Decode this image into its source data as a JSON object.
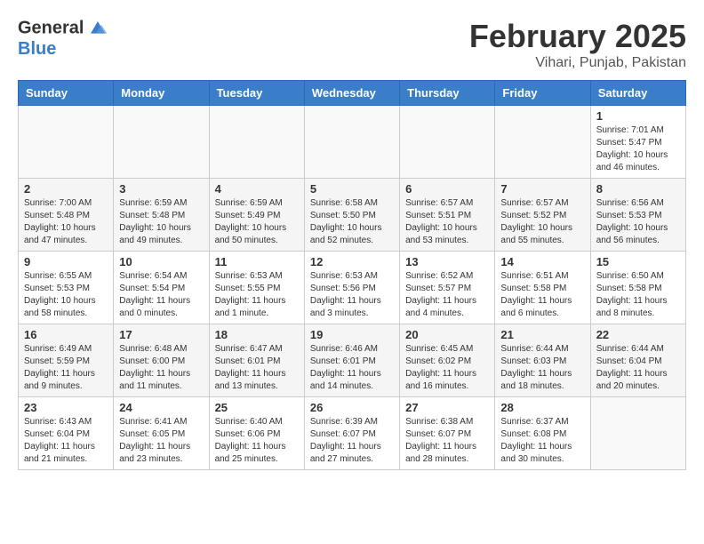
{
  "header": {
    "logo_general": "General",
    "logo_blue": "Blue",
    "month_year": "February 2025",
    "location": "Vihari, Punjab, Pakistan"
  },
  "weekdays": [
    "Sunday",
    "Monday",
    "Tuesday",
    "Wednesday",
    "Thursday",
    "Friday",
    "Saturday"
  ],
  "weeks": [
    [
      {
        "day": "",
        "info": ""
      },
      {
        "day": "",
        "info": ""
      },
      {
        "day": "",
        "info": ""
      },
      {
        "day": "",
        "info": ""
      },
      {
        "day": "",
        "info": ""
      },
      {
        "day": "",
        "info": ""
      },
      {
        "day": "1",
        "info": "Sunrise: 7:01 AM\nSunset: 5:47 PM\nDaylight: 10 hours and 46 minutes."
      }
    ],
    [
      {
        "day": "2",
        "info": "Sunrise: 7:00 AM\nSunset: 5:48 PM\nDaylight: 10 hours and 47 minutes."
      },
      {
        "day": "3",
        "info": "Sunrise: 6:59 AM\nSunset: 5:48 PM\nDaylight: 10 hours and 49 minutes."
      },
      {
        "day": "4",
        "info": "Sunrise: 6:59 AM\nSunset: 5:49 PM\nDaylight: 10 hours and 50 minutes."
      },
      {
        "day": "5",
        "info": "Sunrise: 6:58 AM\nSunset: 5:50 PM\nDaylight: 10 hours and 52 minutes."
      },
      {
        "day": "6",
        "info": "Sunrise: 6:57 AM\nSunset: 5:51 PM\nDaylight: 10 hours and 53 minutes."
      },
      {
        "day": "7",
        "info": "Sunrise: 6:57 AM\nSunset: 5:52 PM\nDaylight: 10 hours and 55 minutes."
      },
      {
        "day": "8",
        "info": "Sunrise: 6:56 AM\nSunset: 5:53 PM\nDaylight: 10 hours and 56 minutes."
      }
    ],
    [
      {
        "day": "9",
        "info": "Sunrise: 6:55 AM\nSunset: 5:53 PM\nDaylight: 10 hours and 58 minutes."
      },
      {
        "day": "10",
        "info": "Sunrise: 6:54 AM\nSunset: 5:54 PM\nDaylight: 11 hours and 0 minutes."
      },
      {
        "day": "11",
        "info": "Sunrise: 6:53 AM\nSunset: 5:55 PM\nDaylight: 11 hours and 1 minute."
      },
      {
        "day": "12",
        "info": "Sunrise: 6:53 AM\nSunset: 5:56 PM\nDaylight: 11 hours and 3 minutes."
      },
      {
        "day": "13",
        "info": "Sunrise: 6:52 AM\nSunset: 5:57 PM\nDaylight: 11 hours and 4 minutes."
      },
      {
        "day": "14",
        "info": "Sunrise: 6:51 AM\nSunset: 5:58 PM\nDaylight: 11 hours and 6 minutes."
      },
      {
        "day": "15",
        "info": "Sunrise: 6:50 AM\nSunset: 5:58 PM\nDaylight: 11 hours and 8 minutes."
      }
    ],
    [
      {
        "day": "16",
        "info": "Sunrise: 6:49 AM\nSunset: 5:59 PM\nDaylight: 11 hours and 9 minutes."
      },
      {
        "day": "17",
        "info": "Sunrise: 6:48 AM\nSunset: 6:00 PM\nDaylight: 11 hours and 11 minutes."
      },
      {
        "day": "18",
        "info": "Sunrise: 6:47 AM\nSunset: 6:01 PM\nDaylight: 11 hours and 13 minutes."
      },
      {
        "day": "19",
        "info": "Sunrise: 6:46 AM\nSunset: 6:01 PM\nDaylight: 11 hours and 14 minutes."
      },
      {
        "day": "20",
        "info": "Sunrise: 6:45 AM\nSunset: 6:02 PM\nDaylight: 11 hours and 16 minutes."
      },
      {
        "day": "21",
        "info": "Sunrise: 6:44 AM\nSunset: 6:03 PM\nDaylight: 11 hours and 18 minutes."
      },
      {
        "day": "22",
        "info": "Sunrise: 6:44 AM\nSunset: 6:04 PM\nDaylight: 11 hours and 20 minutes."
      }
    ],
    [
      {
        "day": "23",
        "info": "Sunrise: 6:43 AM\nSunset: 6:04 PM\nDaylight: 11 hours and 21 minutes."
      },
      {
        "day": "24",
        "info": "Sunrise: 6:41 AM\nSunset: 6:05 PM\nDaylight: 11 hours and 23 minutes."
      },
      {
        "day": "25",
        "info": "Sunrise: 6:40 AM\nSunset: 6:06 PM\nDaylight: 11 hours and 25 minutes."
      },
      {
        "day": "26",
        "info": "Sunrise: 6:39 AM\nSunset: 6:07 PM\nDaylight: 11 hours and 27 minutes."
      },
      {
        "day": "27",
        "info": "Sunrise: 6:38 AM\nSunset: 6:07 PM\nDaylight: 11 hours and 28 minutes."
      },
      {
        "day": "28",
        "info": "Sunrise: 6:37 AM\nSunset: 6:08 PM\nDaylight: 11 hours and 30 minutes."
      },
      {
        "day": "",
        "info": ""
      }
    ]
  ]
}
